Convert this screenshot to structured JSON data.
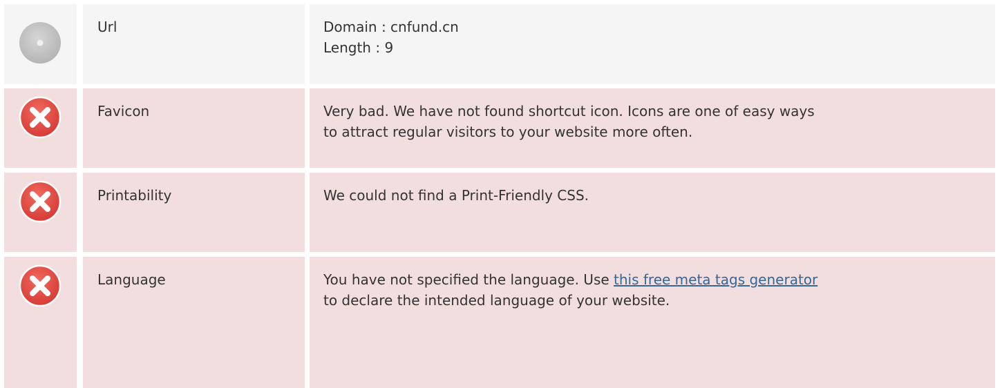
{
  "rows": [
    {
      "label": "Url",
      "status_icon": "neutral-circle-icon",
      "lines": [
        "Domain : cnfund.cn",
        "Length : 9"
      ]
    },
    {
      "label": "Favicon",
      "status_icon": "error-x-icon",
      "lines": [
        "Very bad. We have not found shortcut icon. Icons are one of easy ways",
        "to attract regular visitors to your website more often."
      ]
    },
    {
      "label": "Printability",
      "status_icon": "error-x-icon",
      "lines": [
        "We could not find a Print-Friendly CSS."
      ]
    },
    {
      "label": "Language",
      "status_icon": "error-x-icon",
      "text_before_link": "You have not specified the language. Use ",
      "link_text": "this free meta tags generator",
      "text_after_link": "to declare the intended language of your website."
    }
  ],
  "colors": {
    "neutral_bg": "#f5f5f5",
    "bad_bg": "#f2dede",
    "error_red": "#e0463f",
    "neutral_gray": "#c4c4c4",
    "link": "#336699",
    "text": "#333333"
  }
}
